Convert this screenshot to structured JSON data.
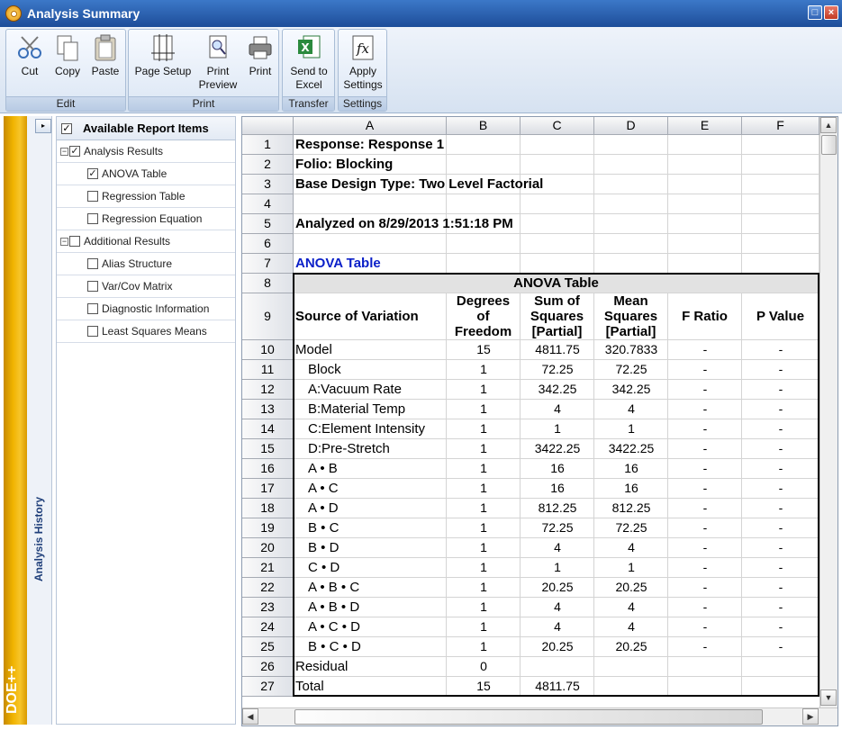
{
  "window": {
    "title": "Analysis Summary"
  },
  "toolbar": {
    "groups": [
      {
        "label": "Edit",
        "buttons": [
          "Cut",
          "Copy",
          "Paste"
        ]
      },
      {
        "label": "Print",
        "buttons": [
          "Page Setup",
          "Print\nPreview",
          "Print"
        ]
      },
      {
        "label": "Transfer",
        "buttons": [
          "Send to\nExcel"
        ]
      },
      {
        "label": "Settings",
        "buttons": [
          "Apply\nSettings"
        ]
      }
    ]
  },
  "sidebar": {
    "brand": "DOE++",
    "history_label": "Analysis History"
  },
  "tree": {
    "header": "Available Report Items",
    "items": [
      {
        "label": "Analysis Results",
        "checked": true,
        "level": 0
      },
      {
        "label": "ANOVA Table",
        "checked": true,
        "level": 1
      },
      {
        "label": "Regression Table",
        "checked": false,
        "level": 1
      },
      {
        "label": "Regression Equation",
        "checked": false,
        "level": 1
      },
      {
        "label": "Additional Results",
        "checked": false,
        "level": 0
      },
      {
        "label": "Alias Structure",
        "checked": false,
        "level": 1
      },
      {
        "label": "Var/Cov Matrix",
        "checked": false,
        "level": 1
      },
      {
        "label": "Diagnostic Information",
        "checked": false,
        "level": 1
      },
      {
        "label": "Least Squares Means",
        "checked": false,
        "level": 1
      }
    ]
  },
  "sheet": {
    "columns": [
      "A",
      "B",
      "C",
      "D",
      "E",
      "F"
    ],
    "rows": [
      "1",
      "2",
      "3",
      "4",
      "5",
      "6",
      "7",
      "8",
      "9",
      "10",
      "11",
      "12",
      "13",
      "14",
      "15",
      "16",
      "17",
      "18",
      "19",
      "20",
      "21",
      "22",
      "23",
      "24",
      "25",
      "26",
      "27"
    ],
    "header_lines": {
      "response": "Response: Response 1",
      "folio": "Folio: Blocking",
      "design": "Base Design Type: Two Level Factorial",
      "analyzed": "Analyzed on 8/29/2013 1:51:18 PM",
      "anova_link": "ANOVA Table"
    },
    "anova": {
      "title": "ANOVA Table",
      "headers": [
        "Source of Variation",
        "Degrees\nof\nFreedom",
        "Sum of\nSquares\n[Partial]",
        "Mean\nSquares\n[Partial]",
        "F Ratio",
        "P Value"
      ],
      "rows": [
        [
          "Model",
          "15",
          "4811.75",
          "320.7833",
          "-",
          "-"
        ],
        [
          "Block",
          "1",
          "72.25",
          "72.25",
          "-",
          "-"
        ],
        [
          "A:Vacuum Rate",
          "1",
          "342.25",
          "342.25",
          "-",
          "-"
        ],
        [
          "B:Material Temp",
          "1",
          "4",
          "4",
          "-",
          "-"
        ],
        [
          "C:Element Intensity",
          "1",
          "1",
          "1",
          "-",
          "-"
        ],
        [
          "D:Pre-Stretch",
          "1",
          "3422.25",
          "3422.25",
          "-",
          "-"
        ],
        [
          "A • B",
          "1",
          "16",
          "16",
          "-",
          "-"
        ],
        [
          "A • C",
          "1",
          "16",
          "16",
          "-",
          "-"
        ],
        [
          "A • D",
          "1",
          "812.25",
          "812.25",
          "-",
          "-"
        ],
        [
          "B • C",
          "1",
          "72.25",
          "72.25",
          "-",
          "-"
        ],
        [
          "B • D",
          "1",
          "4",
          "4",
          "-",
          "-"
        ],
        [
          "C • D",
          "1",
          "1",
          "1",
          "-",
          "-"
        ],
        [
          "A • B • C",
          "1",
          "20.25",
          "20.25",
          "-",
          "-"
        ],
        [
          "A • B • D",
          "1",
          "4",
          "4",
          "-",
          "-"
        ],
        [
          "A • C • D",
          "1",
          "4",
          "4",
          "-",
          "-"
        ],
        [
          "B • C • D",
          "1",
          "20.25",
          "20.25",
          "-",
          "-"
        ],
        [
          "Residual",
          "0",
          "",
          "",
          "",
          ""
        ],
        [
          "Total",
          "15",
          "4811.75",
          "",
          "",
          ""
        ]
      ]
    }
  }
}
